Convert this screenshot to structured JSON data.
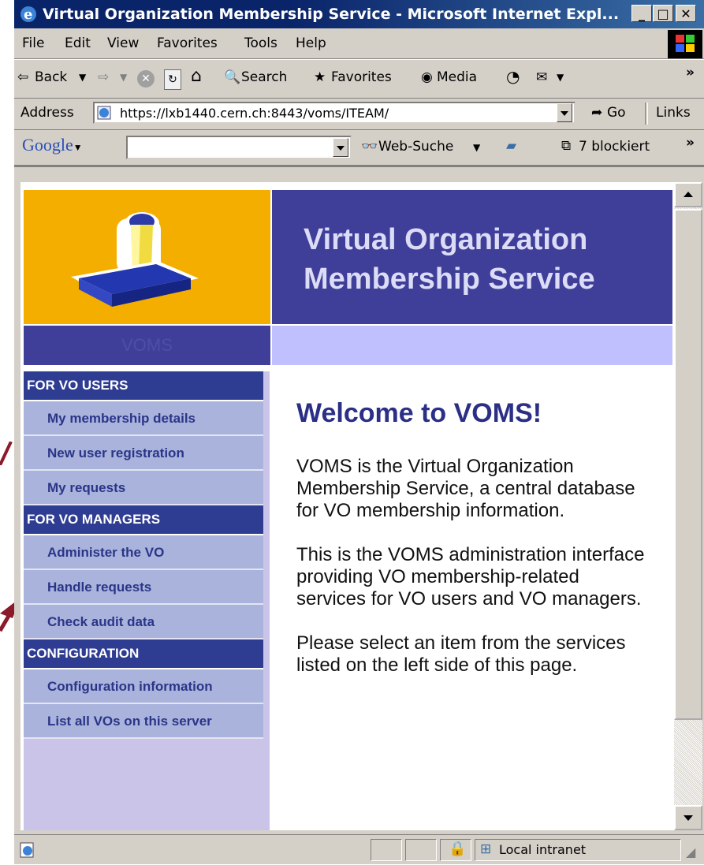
{
  "window": {
    "title": "Virtual Organization Membership Service - Microsoft Internet Expl..."
  },
  "menu": {
    "items": [
      "File",
      "Edit",
      "View",
      "Favorites",
      "Tools",
      "Help"
    ]
  },
  "toolbar": {
    "back_label": "Back",
    "search_label": "Search",
    "favorites_label": "Favorites",
    "media_label": "Media"
  },
  "address": {
    "label": "Address",
    "url": "https://lxb1440.cern.ch:8443/voms/ITEAM/",
    "go_label": "Go",
    "links_label": "Links"
  },
  "google_bar": {
    "brand": "Google",
    "search_button": "Web-Suche",
    "blocked_label": "7 blockiert"
  },
  "page": {
    "header_title_line1": "Virtual Organization",
    "header_title_line2": "Membership Service",
    "logo_label": "VOMS",
    "nav": {
      "users_heading": "FOR VO USERS",
      "users_items": [
        "My membership details",
        "New user registration",
        "My requests"
      ],
      "managers_heading": "FOR VO MANAGERS",
      "managers_items": [
        "Administer the VO",
        "Handle requests",
        "Check audit data"
      ],
      "config_heading": "CONFIGURATION",
      "config_items": [
        "Configuration information",
        "List all VOs on this server"
      ]
    },
    "welcome": "Welcome to VOMS!",
    "paragraphs": [
      "VOMS is the Virtual Organization Membership Service, a central database for VO membership information.",
      "This is the VOMS administration interface providing VO membership-related services for VO users and VO managers.",
      "Please select an item from the services listed on the left side of this page."
    ]
  },
  "status": {
    "zone": "Local intranet"
  },
  "colors": {
    "header_blue": "#3f3f9a",
    "logo_orange": "#f4ae00",
    "nav_link_bg": "#a9b3dc",
    "nav_heading_bg": "#2e3c92"
  }
}
